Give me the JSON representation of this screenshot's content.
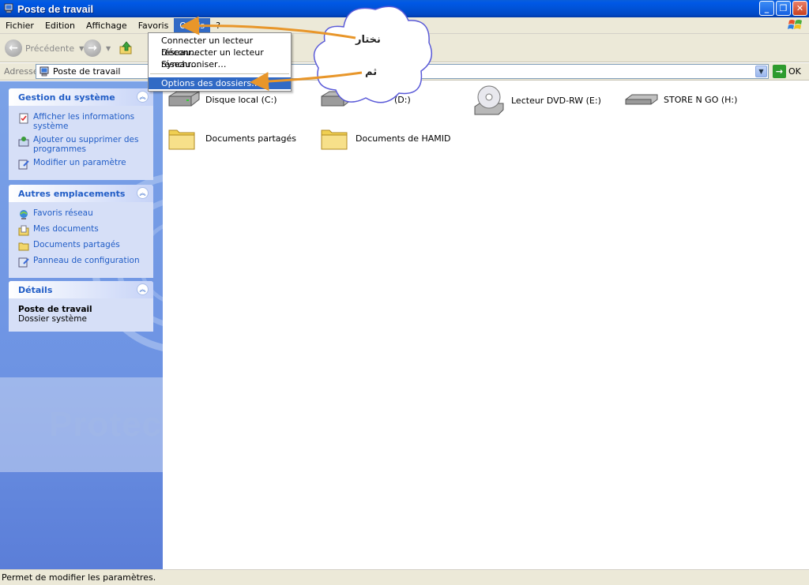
{
  "window": {
    "title": "Poste de travail"
  },
  "menubar": {
    "items": [
      "Fichier",
      "Edition",
      "Affichage",
      "Favoris",
      "Outils",
      "?"
    ]
  },
  "toolbar": {
    "back_label": "Précédente"
  },
  "address": {
    "label": "Adresse",
    "value": "Poste de travail",
    "go_label": "OK"
  },
  "tools_menu": {
    "items": [
      "Connecter un lecteur réseau…",
      "Déconnecter un lecteur réseau…",
      "Synchroniser…",
      "Options des dossiers…"
    ],
    "highlighted": "Options des dossiers…"
  },
  "sidebar": {
    "system_tasks": {
      "title": "Gestion du système",
      "items": [
        "Afficher les informations système",
        "Ajouter ou supprimer des programmes",
        "Modifier un paramètre"
      ]
    },
    "other_places": {
      "title": "Autres emplacements",
      "items": [
        "Favoris réseau",
        "Mes documents",
        "Documents partagés",
        "Panneau de configuration"
      ]
    },
    "details": {
      "title": "Détails",
      "name": "Poste de travail",
      "type": "Dossier système"
    },
    "watermark": "Protec"
  },
  "content": {
    "drives": [
      "Disque local (C:)",
      "(D:)",
      "Lecteur DVD-RW (E:)",
      "STORE N GO (H:)"
    ],
    "folders": [
      "Documents partagés",
      "Documents de HAMID"
    ]
  },
  "annotations": {
    "first": "نختار",
    "second": "ثم",
    "arrow_color": "#e8962a"
  },
  "status": {
    "text": "Permet de modifier les paramètres."
  },
  "colors": {
    "titlebar": "#0052d6",
    "menu_highlight": "#316ac5",
    "link": "#215dc6"
  }
}
